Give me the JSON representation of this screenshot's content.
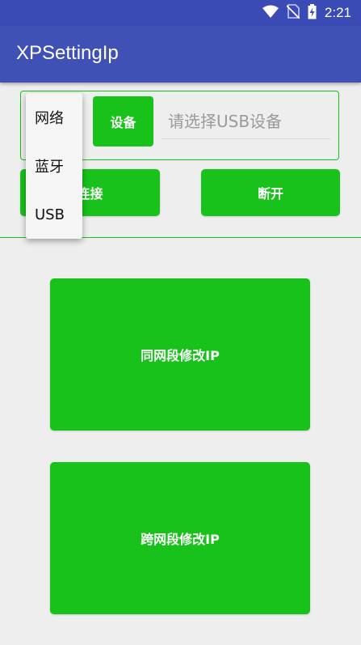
{
  "status": {
    "time": "2:21"
  },
  "app": {
    "title": "XPSettingIp"
  },
  "device": {
    "button_label": "设备",
    "placeholder": "请选择USB设备"
  },
  "actions": {
    "connect": "连接",
    "disconnect": "断开",
    "same_segment": "同网段修改IP",
    "cross_segment": "跨网段修改IP"
  },
  "popup": {
    "items": [
      "网络",
      "蓝牙",
      "USB"
    ]
  },
  "colors": {
    "primary": "#3f51b5",
    "status_bar": "#3a4bb5",
    "accent_green": "#19c11b",
    "background": "#eeeeee"
  },
  "icons": [
    "wifi-icon",
    "no-sim-icon",
    "battery-charging-icon"
  ]
}
